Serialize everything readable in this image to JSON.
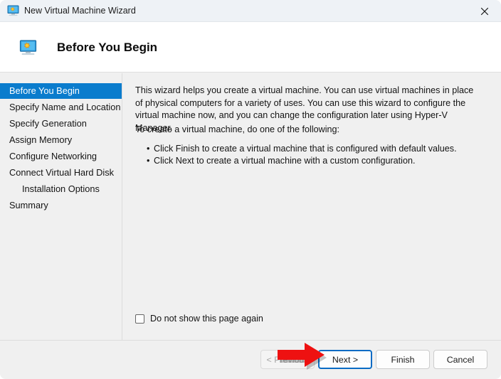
{
  "window": {
    "title": "New Virtual Machine Wizard",
    "icon": "virtual-machine-icon",
    "close_label": "×"
  },
  "header": {
    "title": "Before You Begin",
    "icon": "virtual-machine-icon"
  },
  "sidebar": {
    "items": [
      {
        "label": "Before You Begin",
        "selected": true,
        "indented": false
      },
      {
        "label": "Specify Name and Location",
        "selected": false,
        "indented": false
      },
      {
        "label": "Specify Generation",
        "selected": false,
        "indented": false
      },
      {
        "label": "Assign Memory",
        "selected": false,
        "indented": false
      },
      {
        "label": "Configure Networking",
        "selected": false,
        "indented": false
      },
      {
        "label": "Connect Virtual Hard Disk",
        "selected": false,
        "indented": false
      },
      {
        "label": "Installation Options",
        "selected": false,
        "indented": true
      },
      {
        "label": "Summary",
        "selected": false,
        "indented": false
      }
    ]
  },
  "content": {
    "intro": "This wizard helps you create a virtual machine. You can use virtual machines in place of physical computers for a variety of uses. You can use this wizard to configure the virtual machine now, and you can change the configuration later using Hyper-V Manager.",
    "instruction": "To create a virtual machine, do one of the following:",
    "bullets": [
      "Click Finish to create a virtual machine that is configured with default values.",
      "Click Next to create a virtual machine with a custom configuration."
    ],
    "dont_show_label": "Do not show this page again",
    "dont_show_checked": false
  },
  "footer": {
    "previous_label": "< Previous",
    "next_label": "Next >",
    "finish_label": "Finish",
    "cancel_label": "Cancel"
  },
  "annotation": {
    "type": "red-arrow",
    "points_to": "Next >",
    "color": "#ee1111"
  },
  "colors": {
    "accent_blue": "#0a7ccd",
    "focus_blue": "#0a6bc4",
    "titlebar": "#eef2f6",
    "body": "#f0f0f0",
    "arrow_red": "#ee1111"
  }
}
